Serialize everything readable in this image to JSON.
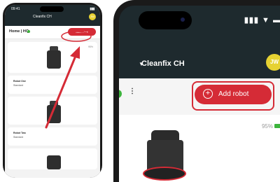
{
  "left_phone": {
    "status_time": "09:41",
    "header_title": "Cleanfix CH",
    "avatar_initials": "JW",
    "section_title": "Home | HQ",
    "add_robot_label": "Add robot",
    "card_names": [
      "Robot One",
      "Robot Two"
    ],
    "card_subtitles": [
      "Standard",
      "Standard"
    ],
    "battery": "95%"
  },
  "right_phone": {
    "status_icons": "▮▮▮ ▼ ▬",
    "header_title": "Cleanfix CH",
    "avatar_initials": "JW",
    "add_robot_label": "Add robot",
    "battery": "95%"
  },
  "colors": {
    "brand_red": "#d52b36",
    "header_dark": "#1e2a2e",
    "accent_green": "#3cb43c",
    "avatar_yellow": "#e6d232"
  }
}
